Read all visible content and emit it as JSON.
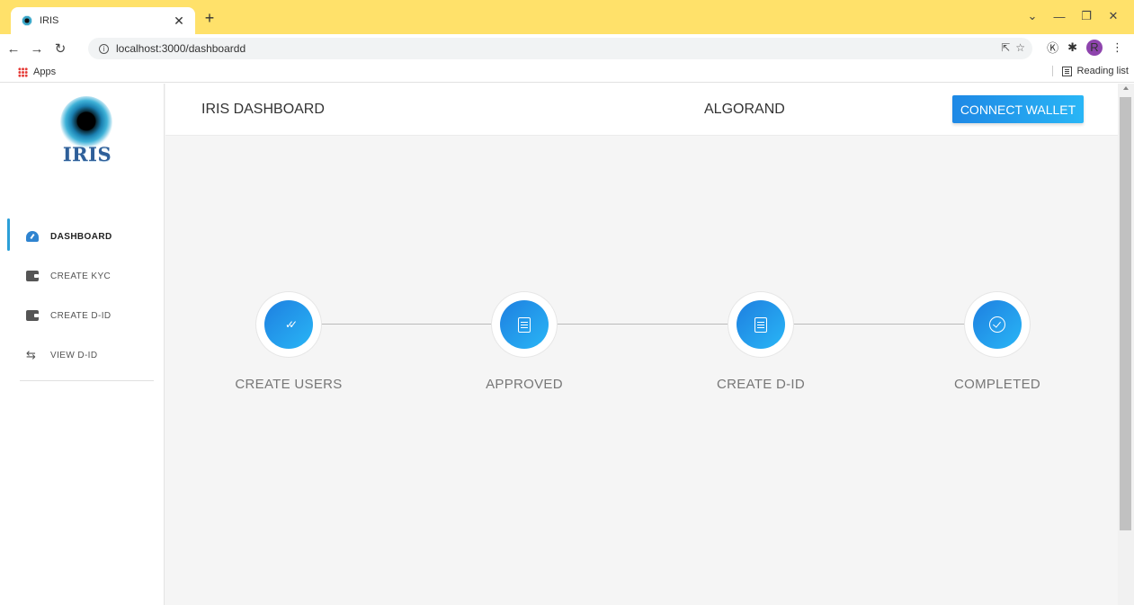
{
  "browser": {
    "tab_title": "IRIS",
    "url": "localhost:3000/dashboardd",
    "bookmarks_apps": "Apps",
    "reading_list": "Reading list",
    "profile_initial": "R"
  },
  "sidebar": {
    "logo_text": "IRIS",
    "items": [
      {
        "label": "DASHBOARD",
        "icon": "dashboard-gauge-icon",
        "active": true
      },
      {
        "label": "CREATE KYC",
        "icon": "wallet-icon",
        "active": false
      },
      {
        "label": "CREATE D-ID",
        "icon": "wallet-icon",
        "active": false
      },
      {
        "label": "VIEW D-ID",
        "icon": "repeat-icon",
        "active": false
      }
    ]
  },
  "header": {
    "title": "IRIS DASHBOARD",
    "network": "ALGORAND",
    "connect_label": "CONNECT WALLET"
  },
  "steps": [
    {
      "label": "CREATE USERS",
      "icon": "double-check-icon"
    },
    {
      "label": "APPROVED",
      "icon": "document-icon"
    },
    {
      "label": "CREATE D-ID",
      "icon": "document-icon"
    },
    {
      "label": "COMPLETED",
      "icon": "check-circle-icon"
    }
  ],
  "colors": {
    "accent": "#1e88e5",
    "accent_light": "#29b6f6",
    "tabbar": "#ffe16a"
  }
}
